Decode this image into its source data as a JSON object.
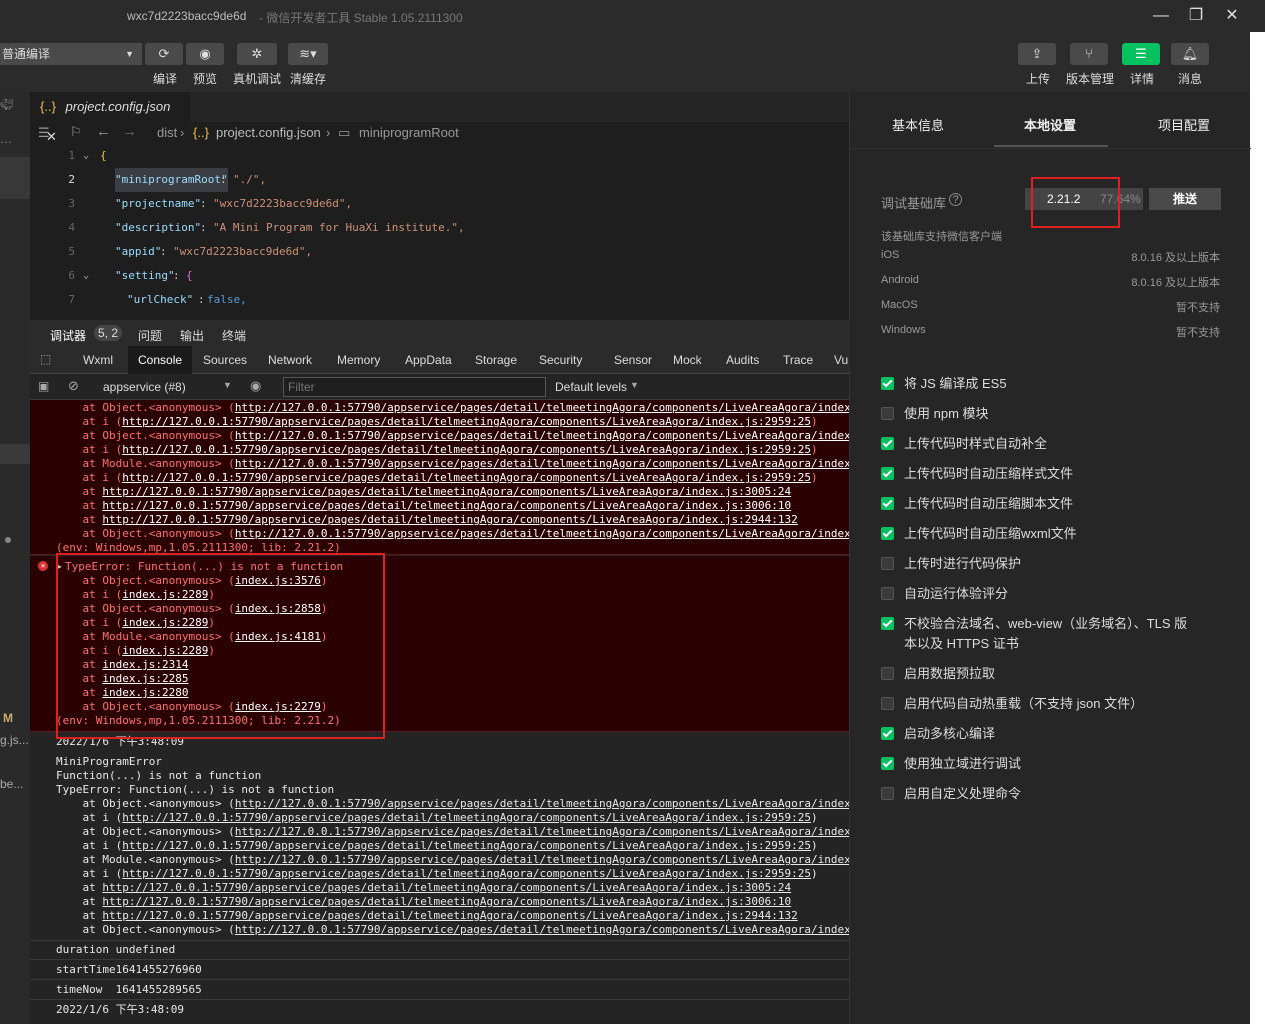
{
  "window": {
    "appid_title": "wxc7d2223bacc9de6d",
    "app_title": " - 微信开发者工具 Stable 1.05.2111300",
    "minimize": "—",
    "maximize": "❐",
    "close": "✕"
  },
  "toolbar": {
    "compile_mode": "普通编译",
    "compile_label": "编译",
    "preview_label": "预览",
    "remote_debug_label": "真机调试",
    "clear_cache_label": "清缓存",
    "upload_label": "上传",
    "version_label": "版本管理",
    "details_label": "详情",
    "messages_label": "消息"
  },
  "editor": {
    "tab_label": "project.config.json",
    "tab_icon": "{..}",
    "breadcrumb": [
      "dist",
      "project.config.json",
      "miniprogramRoot"
    ],
    "lines": [
      {
        "n": "1",
        "text": "{"
      },
      {
        "n": "2",
        "key": "\"miniprogramRoot\"",
        "value": "\"./\","
      },
      {
        "n": "3",
        "key": "\"projectname\"",
        "value": "\"wxc7d2223bacc9de6d\","
      },
      {
        "n": "4",
        "key": "\"description\"",
        "value": "\"A Mini Program for HuaXi institute.\","
      },
      {
        "n": "5",
        "key": "\"appid\"",
        "value": "\"wxc7d2223bacc9de6d\","
      },
      {
        "n": "6",
        "key": "\"setting\"",
        "value": "{"
      },
      {
        "n": "7",
        "key": "\"urlCheck\"",
        "value": "false,"
      }
    ]
  },
  "devtools": {
    "top_tabs": {
      "debugger": "调试器",
      "badge": "5, 2",
      "issues": "问题",
      "output": "输出",
      "terminal": "终端"
    },
    "panels": [
      "Wxml",
      "Console",
      "Sources",
      "Network",
      "Memory",
      "AppData",
      "Storage",
      "Security",
      "Sensor",
      "Mock",
      "Audits",
      "Trace",
      "Vu"
    ],
    "context": "appservice (#8)",
    "filter_placeholder": "Filter",
    "levels": "Default levels"
  },
  "console": {
    "block1": [
      {
        "pre": "    at Object.<anonymous> (",
        "link": "http://127.0.0.1:57790/appservice/pages/detail/telmeetingAgora/components/LiveAreaAgora/index"
      },
      {
        "pre": "    at i (",
        "link": "http://127.0.0.1:57790/appservice/pages/detail/telmeetingAgora/components/LiveAreaAgora/index.js:2959:25",
        "post": ")"
      },
      {
        "pre": "    at Object.<anonymous> (",
        "link": "http://127.0.0.1:57790/appservice/pages/detail/telmeetingAgora/components/LiveAreaAgora/index"
      },
      {
        "pre": "    at i (",
        "link": "http://127.0.0.1:57790/appservice/pages/detail/telmeetingAgora/components/LiveAreaAgora/index.js:2959:25",
        "post": ")"
      },
      {
        "pre": "    at Module.<anonymous> (",
        "link": "http://127.0.0.1:57790/appservice/pages/detail/telmeetingAgora/components/LiveAreaAgora/index"
      },
      {
        "pre": "    at i (",
        "link": "http://127.0.0.1:57790/appservice/pages/detail/telmeetingAgora/components/LiveAreaAgora/index.js:2959:25",
        "post": ")"
      },
      {
        "pre": "    at ",
        "link": "http://127.0.0.1:57790/appservice/pages/detail/telmeetingAgora/components/LiveAreaAgora/index.js:3005:24"
      },
      {
        "pre": "    at ",
        "link": "http://127.0.0.1:57790/appservice/pages/detail/telmeetingAgora/components/LiveAreaAgora/index.js:3006:10"
      },
      {
        "pre": "    at ",
        "link": "http://127.0.0.1:57790/appservice/pages/detail/telmeetingAgora/components/LiveAreaAgora/index.js:2944:132"
      },
      {
        "pre": "    at Object.<anonymous> (",
        "link": "http://127.0.0.1:57790/appservice/pages/detail/telmeetingAgora/components/LiveAreaAgora/index"
      }
    ],
    "block1_env": "(env: Windows,mp,1.05.2111300; lib: 2.21.2)",
    "error_title": "TypeError: Function(...) is not a function",
    "block2": [
      {
        "pre": "    at Object.<anonymous> (",
        "link": "index.js:3576",
        "post": ")"
      },
      {
        "pre": "    at i (",
        "link": "index.js:2289",
        "post": ")"
      },
      {
        "pre": "    at Object.<anonymous> (",
        "link": "index.js:2858",
        "post": ")"
      },
      {
        "pre": "    at i (",
        "link": "index.js:2289",
        "post": ")"
      },
      {
        "pre": "    at Module.<anonymous> (",
        "link": "index.js:4181",
        "post": ")"
      },
      {
        "pre": "    at i (",
        "link": "index.js:2289",
        "post": ")"
      },
      {
        "pre": "    at ",
        "link": "index.js:2314"
      },
      {
        "pre": "    at ",
        "link": "index.js:2285"
      },
      {
        "pre": "    at ",
        "link": "index.js:2280"
      },
      {
        "pre": "    at Object.<anonymous> (",
        "link": "index.js:2279",
        "post": ")"
      }
    ],
    "block2_env": "(env: Windows,mp,1.05.2111300; lib: 2.21.2)",
    "timestamp1": "2022/1/6 下午3:48:09",
    "mp_error": "MiniProgramError",
    "mp_error_msg": "Function(...) is not a function",
    "mp_type_error": "TypeError: Function(...) is not a function",
    "block3": [
      {
        "pre": "    at Object.<anonymous> (",
        "link": "http://127.0.0.1:57790/appservice/pages/detail/telmeetingAgora/components/LiveAreaAgora/index"
      },
      {
        "pre": "    at i (",
        "link": "http://127.0.0.1:57790/appservice/pages/detail/telmeetingAgora/components/LiveAreaAgora/index.js:2959:25",
        "post": ")"
      },
      {
        "pre": "    at Object.<anonymous> (",
        "link": "http://127.0.0.1:57790/appservice/pages/detail/telmeetingAgora/components/LiveAreaAgora/index"
      },
      {
        "pre": "    at i (",
        "link": "http://127.0.0.1:57790/appservice/pages/detail/telmeetingAgora/components/LiveAreaAgora/index.js:2959:25",
        "post": ")"
      },
      {
        "pre": "    at Module.<anonymous> (",
        "link": "http://127.0.0.1:57790/appservice/pages/detail/telmeetingAgora/components/LiveAreaAgora/index"
      },
      {
        "pre": "    at i (",
        "link": "http://127.0.0.1:57790/appservice/pages/detail/telmeetingAgora/components/LiveAreaAgora/index.js:2959:25",
        "post": ")"
      },
      {
        "pre": "    at ",
        "link": "http://127.0.0.1:57790/appservice/pages/detail/telmeetingAgora/components/LiveAreaAgora/index.js:3005:24"
      },
      {
        "pre": "    at ",
        "link": "http://127.0.0.1:57790/appservice/pages/detail/telmeetingAgora/components/LiveAreaAgora/index.js:3006:10"
      },
      {
        "pre": "    at ",
        "link": "http://127.0.0.1:57790/appservice/pages/detail/telmeetingAgora/components/LiveAreaAgora/index.js:2944:132"
      },
      {
        "pre": "    at Object.<anonymous> (",
        "link": "http://127.0.0.1:57790/appservice/pages/detail/telmeetingAgora/components/LiveAreaAgora/index"
      }
    ],
    "duration": "duration undefined",
    "start_time": "startTime1641455276960",
    "time_now": "timeNow  1641455289565",
    "timestamp2": "2022/1/6 下午3:48:09"
  },
  "right_panel": {
    "tabs": [
      "基本信息",
      "本地设置",
      "项目配置"
    ],
    "lib_label": "调试基础库",
    "lib_version": "2.21.2",
    "lib_percent": "77.64%",
    "push_button": "推送",
    "support_title": "该基础库支持微信客户端",
    "platforms": [
      {
        "name": "iOS",
        "value": "8.0.16 及以上版本"
      },
      {
        "name": "Android",
        "value": "8.0.16 及以上版本"
      },
      {
        "name": "MacOS",
        "value": "暂不支持"
      },
      {
        "name": "Windows",
        "value": "暂不支持"
      }
    ],
    "options": [
      {
        "label": "将 JS 编译成 ES5",
        "checked": true
      },
      {
        "label": "使用 npm 模块",
        "checked": false
      },
      {
        "label": "上传代码时样式自动补全",
        "checked": true
      },
      {
        "label": "上传代码时自动压缩样式文件",
        "checked": true
      },
      {
        "label": "上传代码时自动压缩脚本文件",
        "checked": true
      },
      {
        "label": "上传代码时自动压缩wxml文件",
        "checked": true
      },
      {
        "label": "上传时进行代码保护",
        "checked": false
      },
      {
        "label": "自动运行体验评分",
        "checked": false
      },
      {
        "label": "不校验合法域名、web-view（业务域名）、TLS 版",
        "label2": "本以及 HTTPS 证书",
        "checked": true
      },
      {
        "label": "启用数据预拉取",
        "checked": false
      },
      {
        "label": "启用代码自动热重载（不支持 json 文件）",
        "checked": false
      },
      {
        "label": "启动多核心编译",
        "checked": true
      },
      {
        "label": "使用独立域进行调试",
        "checked": true
      },
      {
        "label": "启用自定义处理命令",
        "checked": false
      }
    ]
  },
  "left_bar": {
    "m_label": "M",
    "g_label": "g.js...",
    "be_label": "be..."
  }
}
